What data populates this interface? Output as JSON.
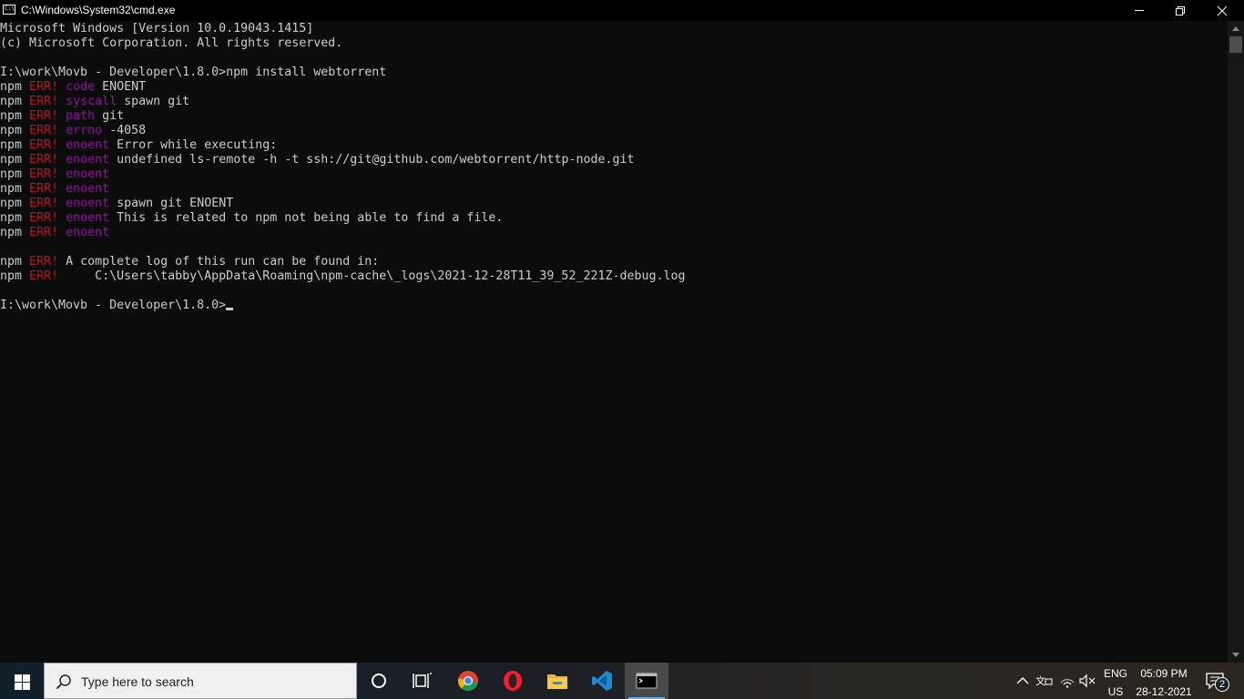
{
  "window": {
    "title": "C:\\Windows\\System32\\cmd.exe",
    "icon_text": "C:\\"
  },
  "console": {
    "lines": [
      [
        {
          "t": "Microsoft Windows [Version 10.0.19043.1415]",
          "c": "n"
        }
      ],
      [
        {
          "t": "(c) Microsoft Corporation. All rights reserved.",
          "c": "n"
        }
      ],
      [],
      [
        {
          "t": "I:\\work\\Movb - Developer\\1.8.0>npm install webtorrent",
          "c": "n"
        }
      ],
      [
        {
          "t": "npm ",
          "c": "n"
        },
        {
          "t": "ERR!",
          "c": "err"
        },
        {
          "t": " ",
          "c": "n"
        },
        {
          "t": "code",
          "c": "kw"
        },
        {
          "t": " ENOENT",
          "c": "n"
        }
      ],
      [
        {
          "t": "npm ",
          "c": "n"
        },
        {
          "t": "ERR!",
          "c": "err"
        },
        {
          "t": " ",
          "c": "n"
        },
        {
          "t": "syscall",
          "c": "kw"
        },
        {
          "t": " spawn git",
          "c": "n"
        }
      ],
      [
        {
          "t": "npm ",
          "c": "n"
        },
        {
          "t": "ERR!",
          "c": "err"
        },
        {
          "t": " ",
          "c": "n"
        },
        {
          "t": "path",
          "c": "kw"
        },
        {
          "t": " git",
          "c": "n"
        }
      ],
      [
        {
          "t": "npm ",
          "c": "n"
        },
        {
          "t": "ERR!",
          "c": "err"
        },
        {
          "t": " ",
          "c": "n"
        },
        {
          "t": "errno",
          "c": "kw"
        },
        {
          "t": " -4058",
          "c": "n"
        }
      ],
      [
        {
          "t": "npm ",
          "c": "n"
        },
        {
          "t": "ERR!",
          "c": "err"
        },
        {
          "t": " ",
          "c": "n"
        },
        {
          "t": "enoent",
          "c": "kw"
        },
        {
          "t": " Error while executing:",
          "c": "n"
        }
      ],
      [
        {
          "t": "npm ",
          "c": "n"
        },
        {
          "t": "ERR!",
          "c": "err"
        },
        {
          "t": " ",
          "c": "n"
        },
        {
          "t": "enoent",
          "c": "kw"
        },
        {
          "t": " undefined ls-remote -h -t ssh://git@github.com/webtorrent/http-node.git",
          "c": "n"
        }
      ],
      [
        {
          "t": "npm ",
          "c": "n"
        },
        {
          "t": "ERR!",
          "c": "err"
        },
        {
          "t": " ",
          "c": "n"
        },
        {
          "t": "enoent",
          "c": "kw"
        }
      ],
      [
        {
          "t": "npm ",
          "c": "n"
        },
        {
          "t": "ERR!",
          "c": "err"
        },
        {
          "t": " ",
          "c": "n"
        },
        {
          "t": "enoent",
          "c": "kw"
        }
      ],
      [
        {
          "t": "npm ",
          "c": "n"
        },
        {
          "t": "ERR!",
          "c": "err"
        },
        {
          "t": " ",
          "c": "n"
        },
        {
          "t": "enoent",
          "c": "kw"
        },
        {
          "t": " spawn git ENOENT",
          "c": "n"
        }
      ],
      [
        {
          "t": "npm ",
          "c": "n"
        },
        {
          "t": "ERR!",
          "c": "err"
        },
        {
          "t": " ",
          "c": "n"
        },
        {
          "t": "enoent",
          "c": "kw"
        },
        {
          "t": " This is related to npm not being able to find a file.",
          "c": "n"
        }
      ],
      [
        {
          "t": "npm ",
          "c": "n"
        },
        {
          "t": "ERR!",
          "c": "err"
        },
        {
          "t": " ",
          "c": "n"
        },
        {
          "t": "enoent",
          "c": "kw"
        }
      ],
      [],
      [
        {
          "t": "npm ",
          "c": "n"
        },
        {
          "t": "ERR!",
          "c": "err"
        },
        {
          "t": " A complete log of this run can be found in:",
          "c": "n"
        }
      ],
      [
        {
          "t": "npm ",
          "c": "n"
        },
        {
          "t": "ERR!",
          "c": "err"
        },
        {
          "t": "     C:\\Users\\tabby\\AppData\\Roaming\\npm-cache\\_logs\\2021-12-28T11_39_52_221Z-debug.log",
          "c": "n"
        }
      ],
      []
    ],
    "prompt": "I:\\work\\Movb - Developer\\1.8.0>"
  },
  "taskbar": {
    "search_placeholder": "Type here to search",
    "apps": [
      "cortana-icon",
      "task-view-icon",
      "chrome-icon",
      "opera-icon",
      "file-explorer-icon",
      "vscode-icon",
      "cmd-icon"
    ],
    "active_app": "cmd-icon",
    "language": "ENG",
    "region": "US",
    "time": "05:09 PM",
    "date": "28-12-2021",
    "notification_count": "2"
  },
  "colors": {
    "console_bg": "#0c0c0c",
    "console_fg": "#cccccc",
    "err": "#c50f1f",
    "keyword": "#881798"
  }
}
